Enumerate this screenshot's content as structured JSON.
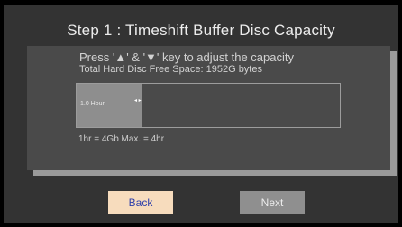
{
  "title": "Step 1 : Timeshift Buffer Disc Capacity",
  "instruction": "Press '▲' & '▼' key to adjust the capacity",
  "free_space": "Total Hard Disc Free Space: 1952G bytes",
  "capacity": {
    "value_label": "1.0 Hour",
    "arrows": "◂ ▸",
    "level_fraction": 0.25
  },
  "capacity_note": "1hr = 4Gb  Max. = 4hr",
  "buttons": {
    "back": "Back",
    "next": "Next"
  },
  "colors": {
    "back_bg": "#f7dcbd",
    "next_bg": "#8f8f8f"
  }
}
